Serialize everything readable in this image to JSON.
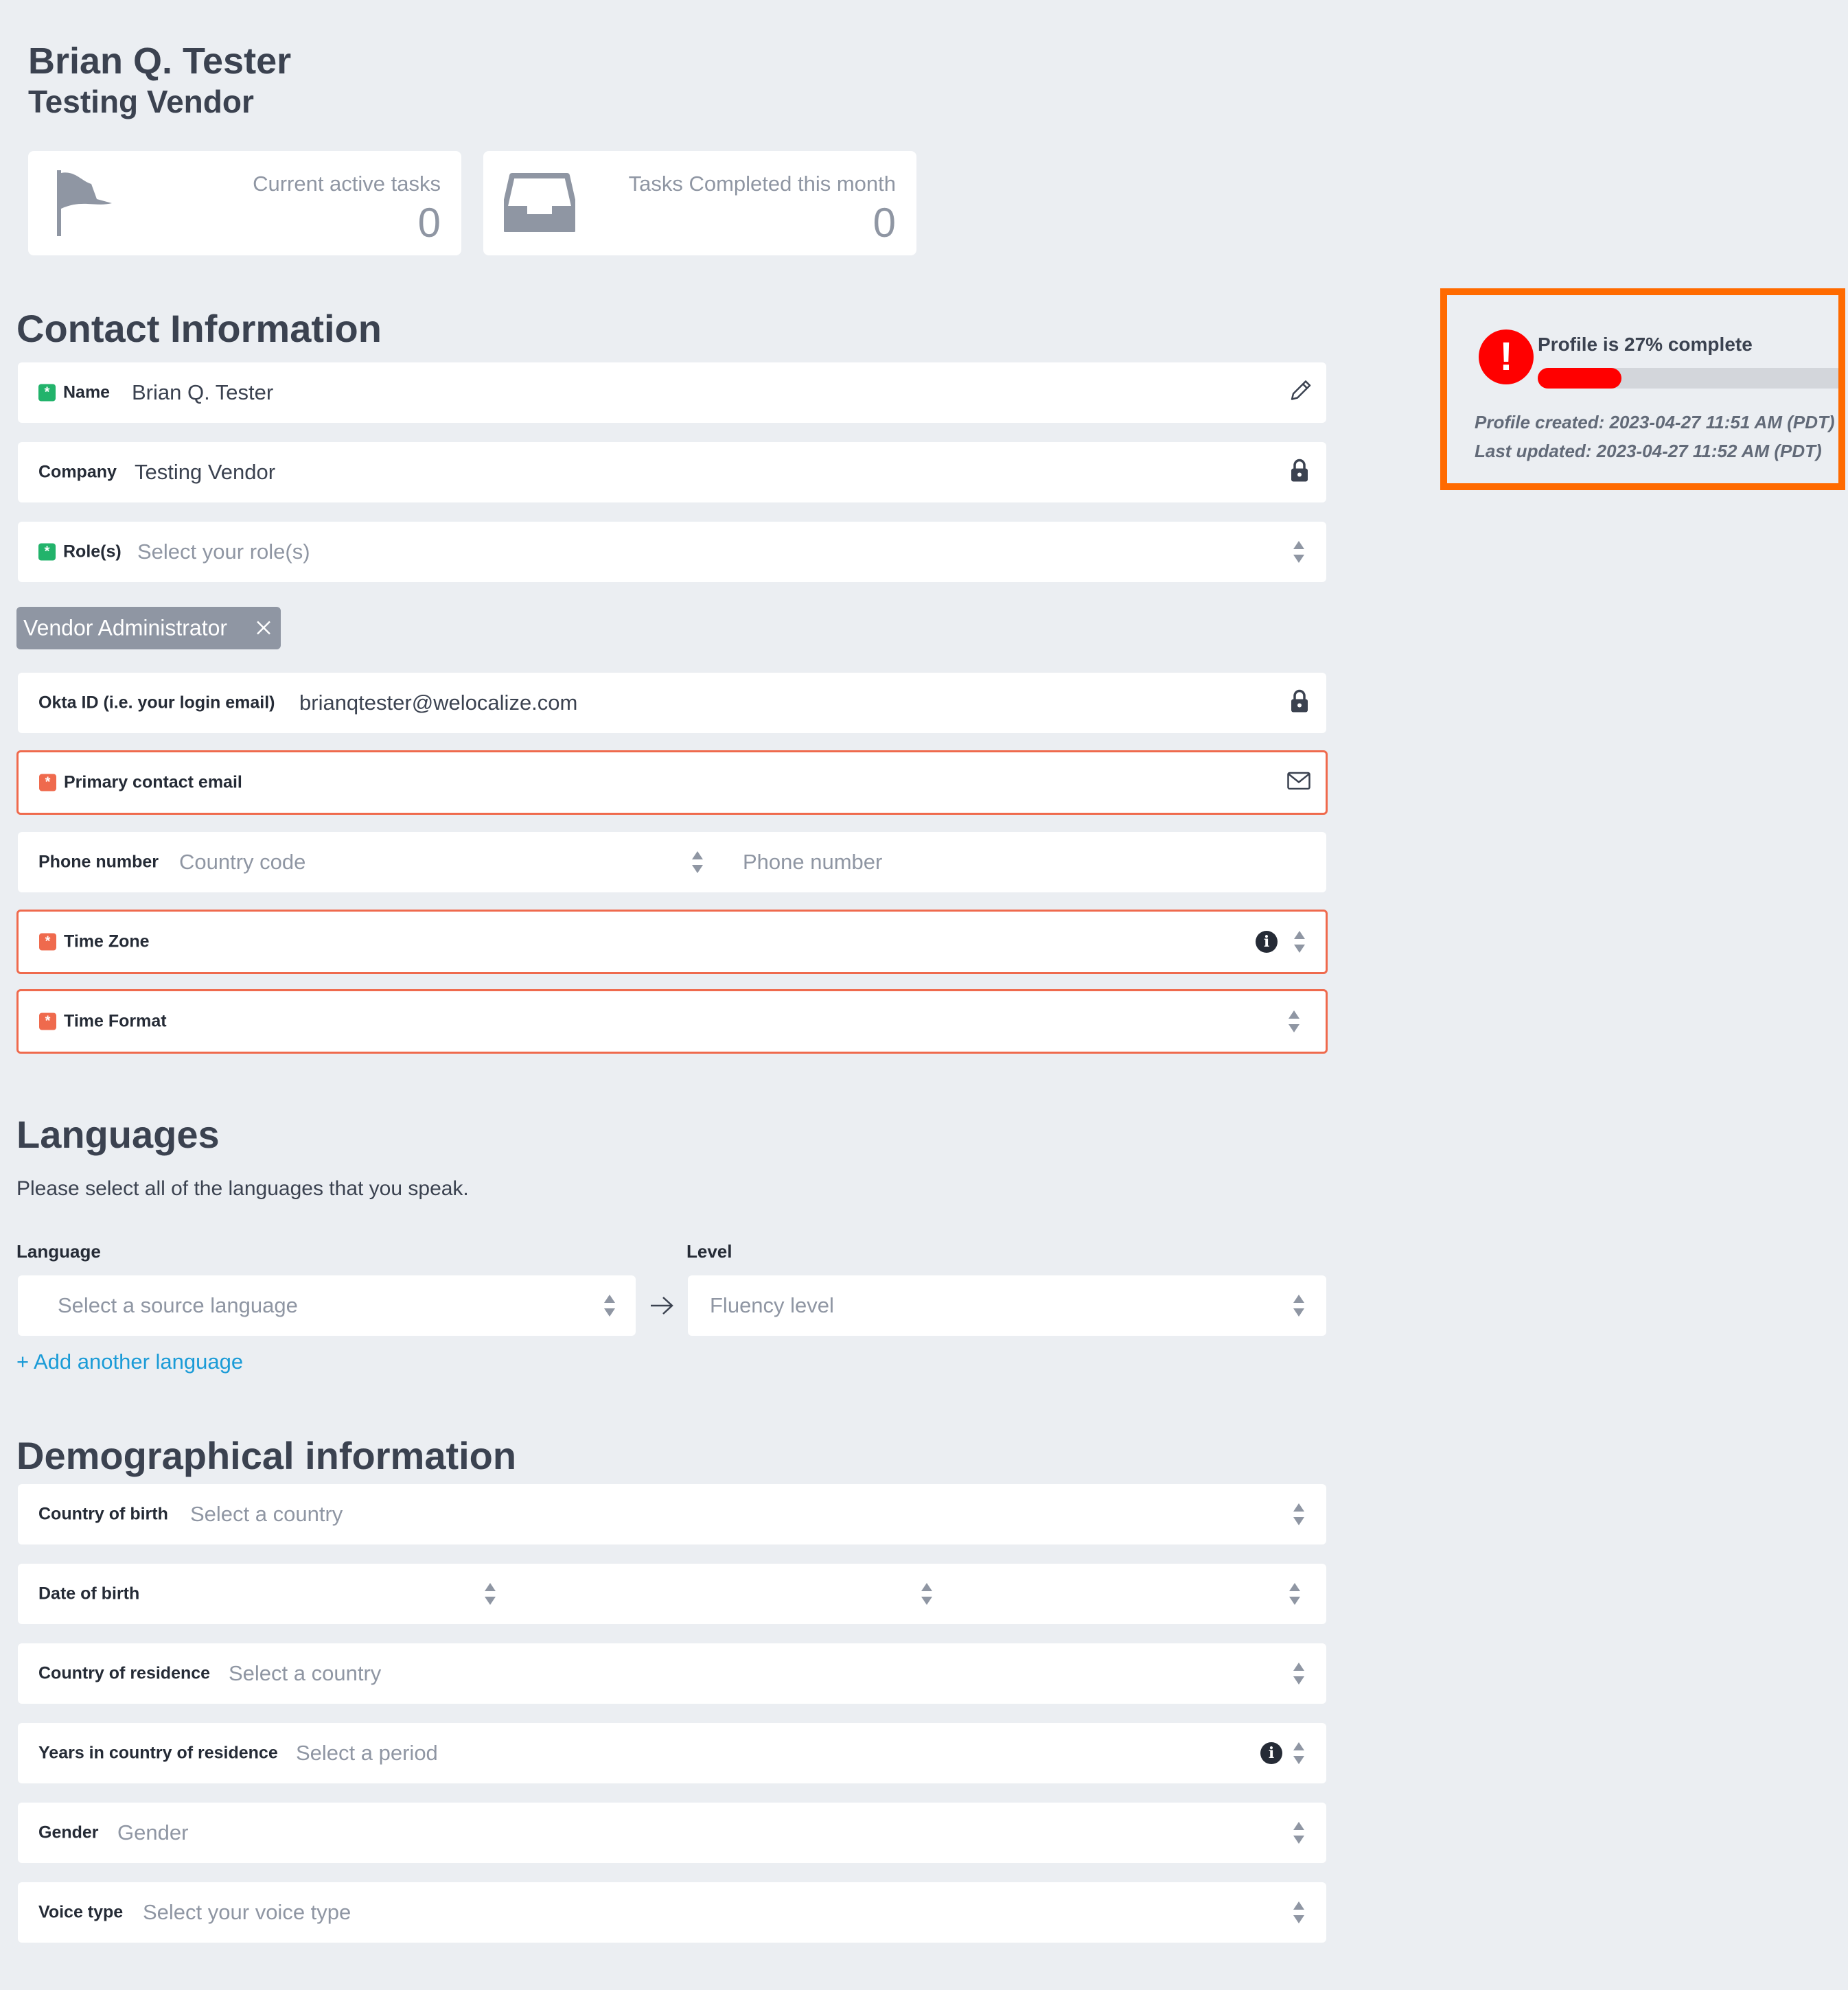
{
  "header": {
    "name": "Brian Q. Tester",
    "company": "Testing Vendor"
  },
  "stats": {
    "active": {
      "label": "Current active tasks",
      "value": "0",
      "icon": "flag-icon"
    },
    "completed": {
      "label": "Tasks Completed this month",
      "value": "0",
      "icon": "inbox-icon"
    }
  },
  "contact": {
    "title": "Contact Information",
    "name": {
      "label": "Name",
      "value": "Brian Q. Tester"
    },
    "company": {
      "label": "Company",
      "value": "Testing Vendor"
    },
    "roles": {
      "label": "Role(s)",
      "placeholder": "Select your role(s)",
      "selected": [
        "Vendor Administrator"
      ]
    },
    "okta": {
      "label": "Okta ID (i.e. your login email)",
      "value": "brianqtester@welocalize.com"
    },
    "primary_email": {
      "label": "Primary contact email",
      "value": ""
    },
    "phone": {
      "label": "Phone number",
      "country_placeholder": "Country code",
      "number_placeholder": "Phone number"
    },
    "timezone": {
      "label": "Time Zone"
    },
    "timeformat": {
      "label": "Time Format"
    }
  },
  "languages": {
    "title": "Languages",
    "description": "Please select all of the languages that you speak.",
    "language_label": "Language",
    "level_label": "Level",
    "language_placeholder": "Select a source language",
    "level_placeholder": "Fluency level",
    "add_link": "+ Add another language"
  },
  "demographics": {
    "title": "Demographical information",
    "country_of_birth": {
      "label": "Country of birth",
      "placeholder": "Select a country"
    },
    "date_of_birth": {
      "label": "Date of birth"
    },
    "country_of_residence": {
      "label": "Country of residence",
      "placeholder": "Select a country"
    },
    "years_in_country": {
      "label": "Years in country of residence",
      "placeholder": "Select a period"
    },
    "gender": {
      "label": "Gender",
      "placeholder": "Gender"
    },
    "voice_type": {
      "label": "Voice type",
      "placeholder": "Select your voice type"
    }
  },
  "profile": {
    "completion_text": "Profile is 27% complete",
    "completion_percent": 27,
    "created": "Profile created: 2023-04-27 11:51 AM (PDT)",
    "updated": "Last updated: 2023-04-27 11:52 AM (PDT)",
    "colors": {
      "highlight": "#ff6a00",
      "alert": "#ff0000",
      "required_ok": "#22b36b",
      "required_missing": "#ef6a4d"
    }
  }
}
